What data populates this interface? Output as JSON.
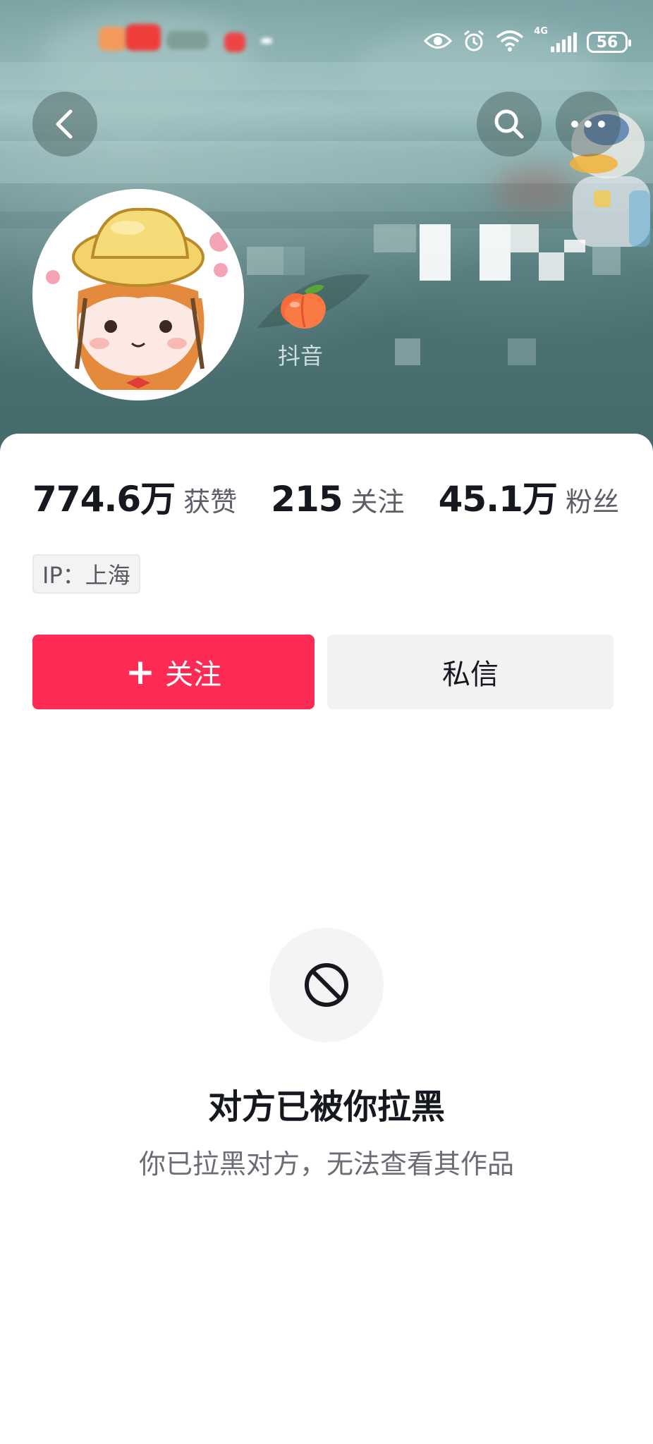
{
  "status_bar": {
    "battery": "56",
    "network": "4G",
    "icons": [
      "eye-icon",
      "alarm-icon",
      "wifi-icon",
      "signal-icon",
      "battery-icon"
    ]
  },
  "header": {
    "icons": [
      "back-icon",
      "search-icon",
      "more-icon"
    ]
  },
  "profile": {
    "badge_emoji": "🍑",
    "badge_sub": "抖音"
  },
  "stats": [
    {
      "value": "774.6万",
      "label": "获赞"
    },
    {
      "value": "215",
      "label": "关注"
    },
    {
      "value": "45.1万",
      "label": "粉丝"
    }
  ],
  "ip_tag": "IP：上海",
  "actions": {
    "follow_plus": "+",
    "follow_label": "关注",
    "message_label": "私信"
  },
  "empty_state": {
    "icon": "block-icon",
    "title": "对方已被你拉黑",
    "description": "你已拉黑对方，无法查看其作品"
  },
  "colors": {
    "accent": "#fe2c55",
    "secondary_button": "#f2f2f3",
    "text_primary": "#16181f",
    "text_secondary": "#6a6d74"
  }
}
